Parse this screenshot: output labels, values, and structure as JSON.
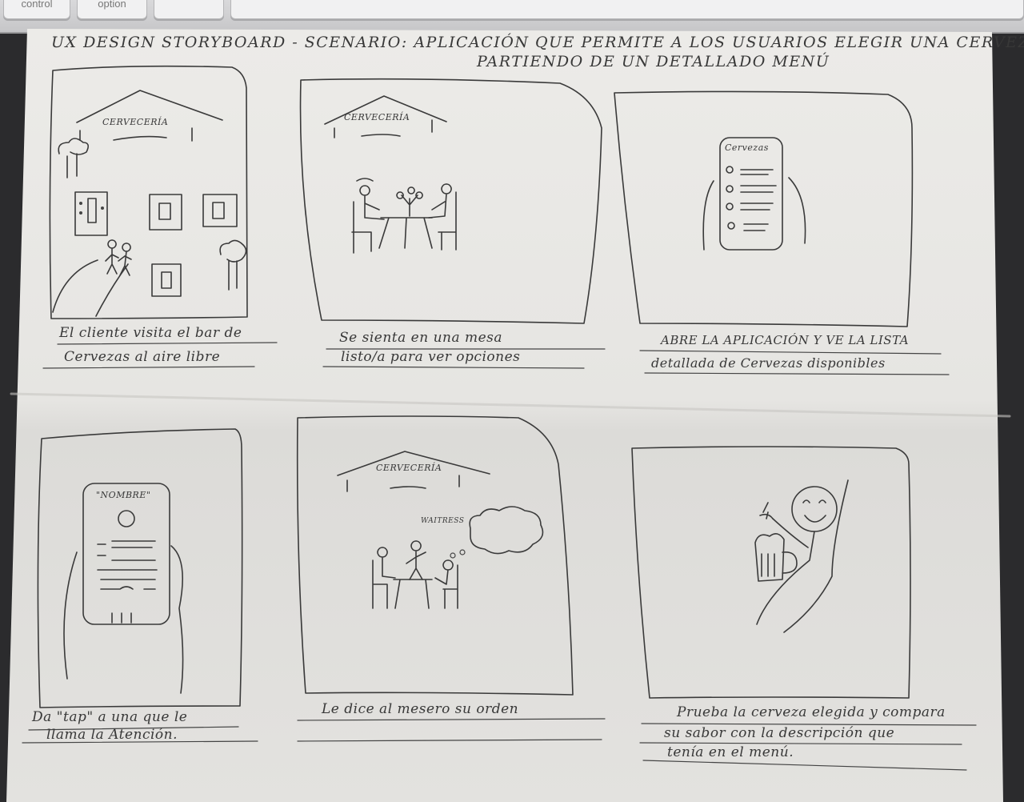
{
  "keyboard": {
    "keys": [
      "control",
      "option"
    ]
  },
  "storyboard": {
    "title_line1": "UX DESIGN STORYBOARD - SCENARIO: APLICACIÓN QUE PERMITE A LOS USUARIOS ELEGIR UNA CERVEZA",
    "title_line2": "PARTIENDO DE UN DETALLADO MENÚ",
    "panels": [
      {
        "sign": "CERVECERÍA",
        "caption1": "El cliente visita el bar de",
        "caption2": "Cervezas al aire libre"
      },
      {
        "sign": "CERVECERÍA",
        "caption1": "Se sienta en una mesa",
        "caption2": "listo/a para ver opciones"
      },
      {
        "sign": "Cervezas",
        "caption1": "ABRE LA APLICACIÓN Y VE LA LISTA",
        "caption2": "detallada de Cervezas disponibles"
      },
      {
        "sign": "\"NOMBRE\"",
        "caption1": "Da \"tap\" a una que le",
        "caption2": "llama la Atención."
      },
      {
        "sign": "CERVECERÍA",
        "sign2": "WAITRESS",
        "caption1": "Le dice al mesero su orden",
        "caption2": ""
      },
      {
        "caption1": "Prueba la cerveza elegida y compara",
        "caption2": "su sabor con la descripción que",
        "caption3": "tenía en el menú."
      }
    ]
  }
}
